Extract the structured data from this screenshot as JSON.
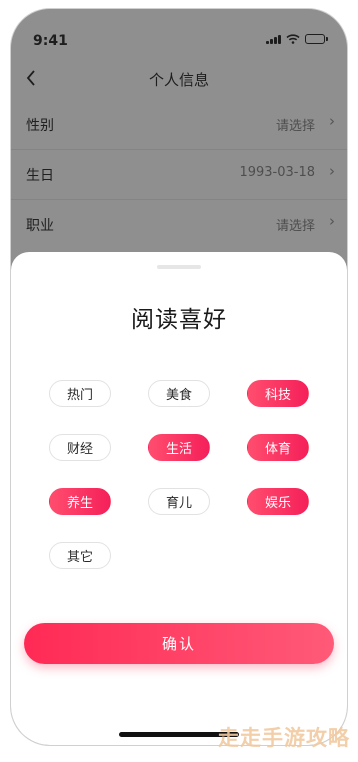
{
  "status": {
    "time": "9:41"
  },
  "nav": {
    "title": "个人信息",
    "back_icon": "chevron-left-icon"
  },
  "rows": [
    {
      "label": "性别",
      "value": "请选择"
    },
    {
      "label": "生日",
      "value": "1993-03-18"
    },
    {
      "label": "职业",
      "value": "请选择"
    }
  ],
  "sheet": {
    "title": "阅读喜好",
    "chips": [
      {
        "label": "热门",
        "selected": false
      },
      {
        "label": "美食",
        "selected": false
      },
      {
        "label": "科技",
        "selected": true
      },
      {
        "label": "财经",
        "selected": false
      },
      {
        "label": "生活",
        "selected": true
      },
      {
        "label": "体育",
        "selected": true
      },
      {
        "label": "养生",
        "selected": true
      },
      {
        "label": "育儿",
        "selected": false
      },
      {
        "label": "娱乐",
        "selected": true
      },
      {
        "label": "其它",
        "selected": false
      }
    ],
    "confirm_label": "确认"
  },
  "colors": {
    "accent": "#ff2a55",
    "overlay": "#8f8f8f"
  },
  "watermark": "走走手游攻略"
}
